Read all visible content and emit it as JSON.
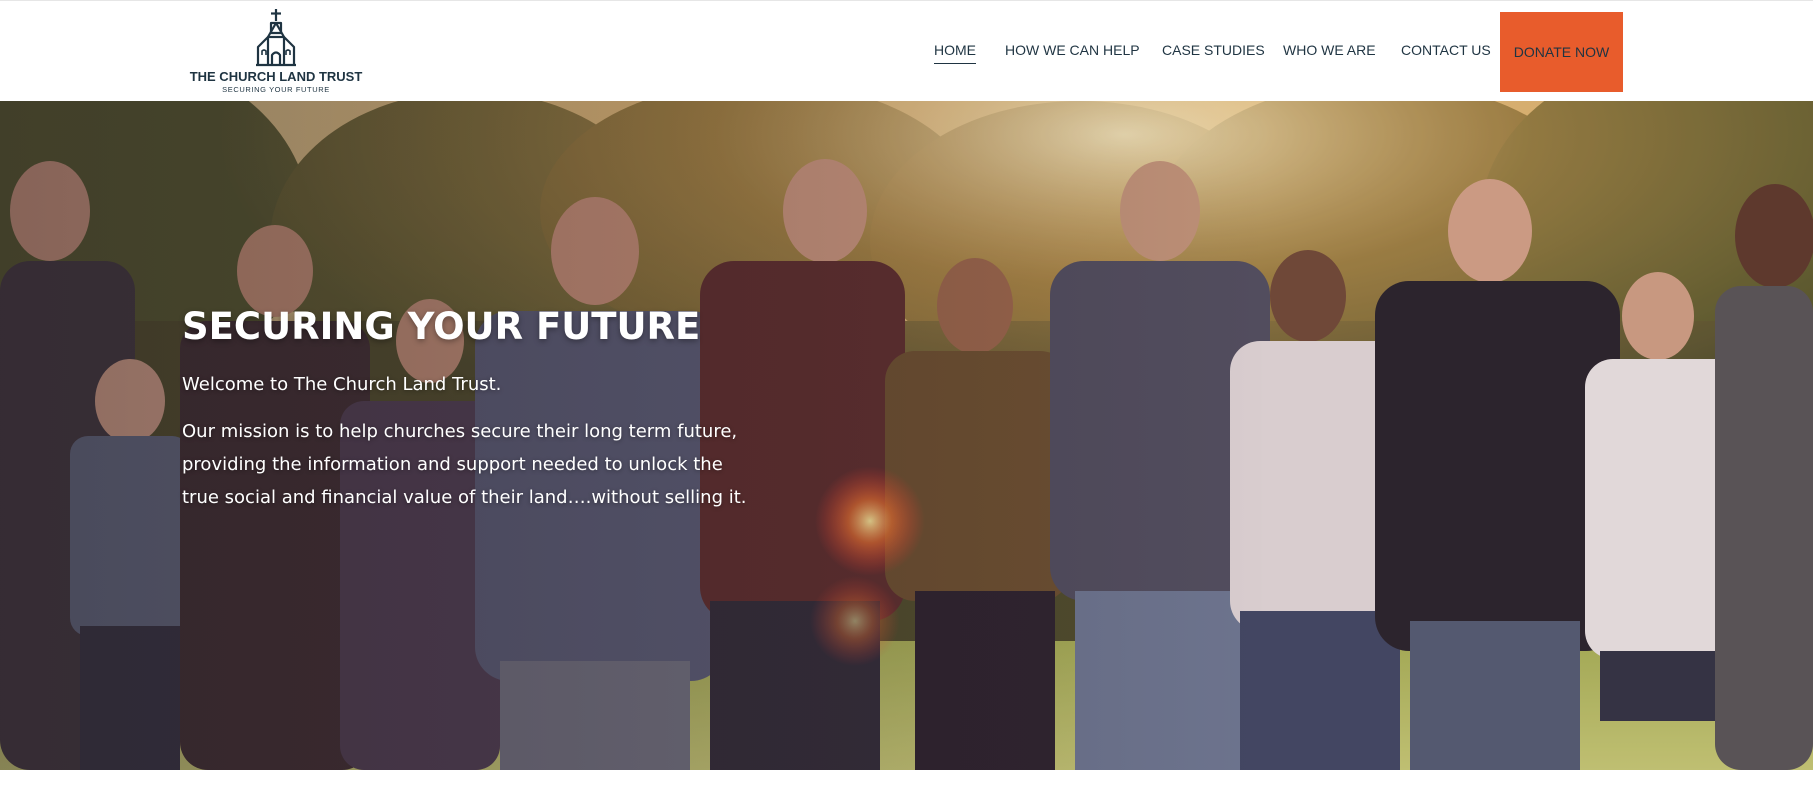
{
  "header": {
    "logo": {
      "title": "THE CHURCH LAND TRUST",
      "tagline": "SECURING YOUR FUTURE",
      "icon": "church-icon",
      "color": "#1f3442"
    },
    "nav": [
      {
        "label": "HOME",
        "active": true
      },
      {
        "label": "HOW WE CAN HELP",
        "active": false
      },
      {
        "label": "CASE STUDIES",
        "active": false
      },
      {
        "label": "WHO WE ARE",
        "active": false
      },
      {
        "label": "CONTACT US",
        "active": false
      }
    ],
    "donate_label": "DONATE NOW",
    "donate_color": "#e85c2c"
  },
  "hero": {
    "title": "SECURING YOUR FUTURE",
    "welcome": "Welcome to The Church Land Trust.",
    "mission": "Our mission is to help churches secure their long term future, providing the information and support needed to unlock the true social and financial value of their land….without selling it.",
    "image": "group-of-diverse-people-photo"
  }
}
